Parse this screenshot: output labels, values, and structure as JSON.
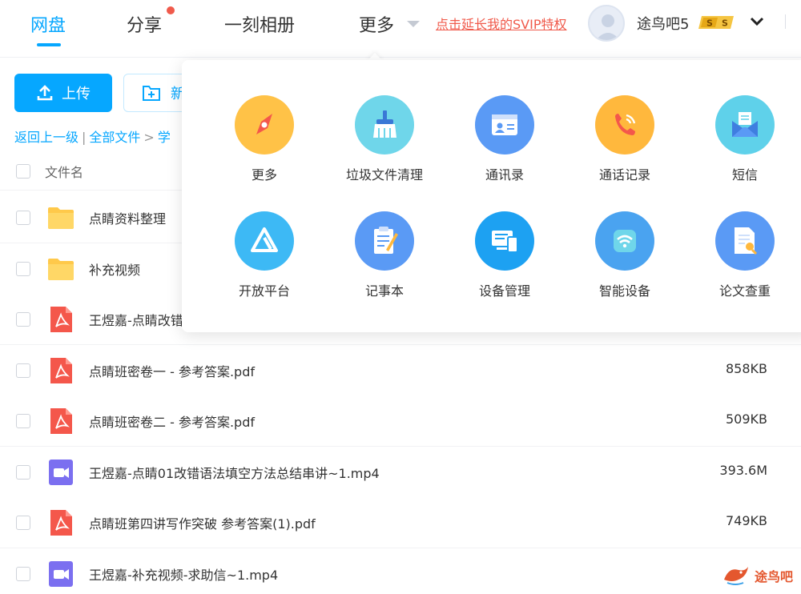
{
  "nav": {
    "tabs": [
      {
        "label": "网盘",
        "active": true
      },
      {
        "label": "分享",
        "has_dot": true
      },
      {
        "label": "一刻相册"
      },
      {
        "label": "更多"
      }
    ],
    "svip_link": "点击延长我的SVIP特权",
    "username": "途鸟吧5",
    "badge": "S"
  },
  "toolbar": {
    "upload_label": "上传",
    "new_label": "新"
  },
  "breadcrumb": {
    "back": "返回上一级",
    "all_files": "全部文件",
    "current": "学"
  },
  "file_list": {
    "header": "文件名",
    "rows": [
      {
        "type": "folder",
        "name": "点睛资料整理",
        "size": ""
      },
      {
        "type": "folder",
        "name": "补充视频",
        "size": ""
      },
      {
        "type": "pdf",
        "name": "王煜嘉-点睛改错",
        "size": ""
      },
      {
        "type": "pdf",
        "name": "点睛班密卷一 - 参考答案.pdf",
        "size": "858KB"
      },
      {
        "type": "pdf",
        "name": "点睛班密卷二 - 参考答案.pdf",
        "size": "509KB"
      },
      {
        "type": "video",
        "name": "王煜嘉-点睛01改错语法填空方法总结串讲~1.mp4",
        "size": "393.6M"
      },
      {
        "type": "pdf",
        "name": "点睛班第四讲写作突破 参考答案(1).pdf",
        "size": "749KB"
      },
      {
        "type": "video",
        "name": "王煜嘉-补充视频-求助信~1.mp4",
        "size": ""
      }
    ]
  },
  "more_panel": {
    "tools": [
      {
        "label": "更多",
        "icon": "compass-icon",
        "color": "#ffc247"
      },
      {
        "label": "垃圾文件清理",
        "icon": "broom-icon",
        "color": "#6fd6ea"
      },
      {
        "label": "通讯录",
        "icon": "contacts-icon",
        "color": "#5a9af5"
      },
      {
        "label": "通话记录",
        "icon": "phone-icon",
        "color": "#ffb83d"
      },
      {
        "label": "短信",
        "icon": "envelope-icon",
        "color": "#5fd1ea"
      },
      {
        "label": "开放平台",
        "icon": "open-platform-icon",
        "color": "#3db9f5"
      },
      {
        "label": "记事本",
        "icon": "notepad-icon",
        "color": "#5a9af5"
      },
      {
        "label": "设备管理",
        "icon": "devices-icon",
        "color": "#1da1f2"
      },
      {
        "label": "智能设备",
        "icon": "wifi-device-icon",
        "color": "#4aa3f0"
      },
      {
        "label": "论文查重",
        "icon": "document-search-icon",
        "color": "#5a9af5"
      }
    ]
  },
  "watermark": {
    "text": "途鸟吧"
  }
}
